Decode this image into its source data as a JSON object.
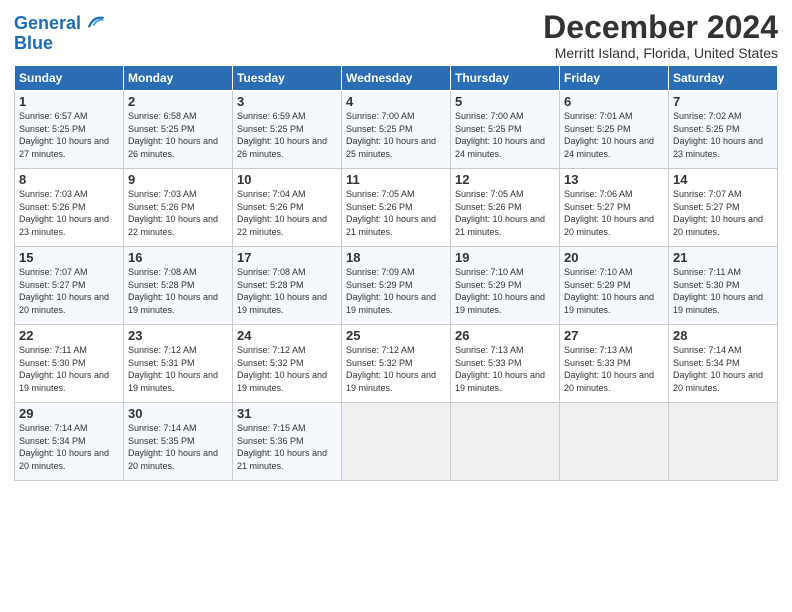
{
  "header": {
    "logo_line1": "General",
    "logo_line2": "Blue",
    "month": "December 2024",
    "location": "Merritt Island, Florida, United States"
  },
  "weekdays": [
    "Sunday",
    "Monday",
    "Tuesday",
    "Wednesday",
    "Thursday",
    "Friday",
    "Saturday"
  ],
  "weeks": [
    [
      {
        "day": "1",
        "rise": "6:57 AM",
        "set": "5:25 PM",
        "daylight": "10 hours and 27 minutes."
      },
      {
        "day": "2",
        "rise": "6:58 AM",
        "set": "5:25 PM",
        "daylight": "10 hours and 26 minutes."
      },
      {
        "day": "3",
        "rise": "6:59 AM",
        "set": "5:25 PM",
        "daylight": "10 hours and 26 minutes."
      },
      {
        "day": "4",
        "rise": "7:00 AM",
        "set": "5:25 PM",
        "daylight": "10 hours and 25 minutes."
      },
      {
        "day": "5",
        "rise": "7:00 AM",
        "set": "5:25 PM",
        "daylight": "10 hours and 24 minutes."
      },
      {
        "day": "6",
        "rise": "7:01 AM",
        "set": "5:25 PM",
        "daylight": "10 hours and 24 minutes."
      },
      {
        "day": "7",
        "rise": "7:02 AM",
        "set": "5:25 PM",
        "daylight": "10 hours and 23 minutes."
      }
    ],
    [
      {
        "day": "8",
        "rise": "7:03 AM",
        "set": "5:26 PM",
        "daylight": "10 hours and 23 minutes."
      },
      {
        "day": "9",
        "rise": "7:03 AM",
        "set": "5:26 PM",
        "daylight": "10 hours and 22 minutes."
      },
      {
        "day": "10",
        "rise": "7:04 AM",
        "set": "5:26 PM",
        "daylight": "10 hours and 22 minutes."
      },
      {
        "day": "11",
        "rise": "7:05 AM",
        "set": "5:26 PM",
        "daylight": "10 hours and 21 minutes."
      },
      {
        "day": "12",
        "rise": "7:05 AM",
        "set": "5:26 PM",
        "daylight": "10 hours and 21 minutes."
      },
      {
        "day": "13",
        "rise": "7:06 AM",
        "set": "5:27 PM",
        "daylight": "10 hours and 20 minutes."
      },
      {
        "day": "14",
        "rise": "7:07 AM",
        "set": "5:27 PM",
        "daylight": "10 hours and 20 minutes."
      }
    ],
    [
      {
        "day": "15",
        "rise": "7:07 AM",
        "set": "5:27 PM",
        "daylight": "10 hours and 20 minutes."
      },
      {
        "day": "16",
        "rise": "7:08 AM",
        "set": "5:28 PM",
        "daylight": "10 hours and 19 minutes."
      },
      {
        "day": "17",
        "rise": "7:08 AM",
        "set": "5:28 PM",
        "daylight": "10 hours and 19 minutes."
      },
      {
        "day": "18",
        "rise": "7:09 AM",
        "set": "5:29 PM",
        "daylight": "10 hours and 19 minutes."
      },
      {
        "day": "19",
        "rise": "7:10 AM",
        "set": "5:29 PM",
        "daylight": "10 hours and 19 minutes."
      },
      {
        "day": "20",
        "rise": "7:10 AM",
        "set": "5:29 PM",
        "daylight": "10 hours and 19 minutes."
      },
      {
        "day": "21",
        "rise": "7:11 AM",
        "set": "5:30 PM",
        "daylight": "10 hours and 19 minutes."
      }
    ],
    [
      {
        "day": "22",
        "rise": "7:11 AM",
        "set": "5:30 PM",
        "daylight": "10 hours and 19 minutes."
      },
      {
        "day": "23",
        "rise": "7:12 AM",
        "set": "5:31 PM",
        "daylight": "10 hours and 19 minutes."
      },
      {
        "day": "24",
        "rise": "7:12 AM",
        "set": "5:32 PM",
        "daylight": "10 hours and 19 minutes."
      },
      {
        "day": "25",
        "rise": "7:12 AM",
        "set": "5:32 PM",
        "daylight": "10 hours and 19 minutes."
      },
      {
        "day": "26",
        "rise": "7:13 AM",
        "set": "5:33 PM",
        "daylight": "10 hours and 19 minutes."
      },
      {
        "day": "27",
        "rise": "7:13 AM",
        "set": "5:33 PM",
        "daylight": "10 hours and 20 minutes."
      },
      {
        "day": "28",
        "rise": "7:14 AM",
        "set": "5:34 PM",
        "daylight": "10 hours and 20 minutes."
      }
    ],
    [
      {
        "day": "29",
        "rise": "7:14 AM",
        "set": "5:34 PM",
        "daylight": "10 hours and 20 minutes."
      },
      {
        "day": "30",
        "rise": "7:14 AM",
        "set": "5:35 PM",
        "daylight": "10 hours and 20 minutes."
      },
      {
        "day": "31",
        "rise": "7:15 AM",
        "set": "5:36 PM",
        "daylight": "10 hours and 21 minutes."
      },
      null,
      null,
      null,
      null
    ]
  ]
}
